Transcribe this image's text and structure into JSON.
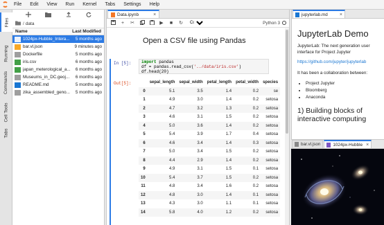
{
  "menubar": {
    "items": [
      "File",
      "Edit",
      "View",
      "Run",
      "Kernel",
      "Tabs",
      "Settings",
      "Help"
    ]
  },
  "sidebar_tabs": [
    "Files",
    "Running",
    "Commands",
    "Cell Tools",
    "Tabs"
  ],
  "filebrowser": {
    "path": "data",
    "col_name": "Name",
    "col_modified": "Last Modified",
    "files": [
      {
        "name": "1024px-Hubble_Intera...",
        "modified": "5 months ago",
        "icon": "image-icon",
        "selected": true
      },
      {
        "name": "bar.vl.json",
        "modified": "9 minutes ago",
        "icon": "json-icon",
        "selected": false
      },
      {
        "name": "Dockerfile",
        "modified": "5 months ago",
        "icon": "file-icon",
        "selected": false
      },
      {
        "name": "iris.csv",
        "modified": "6 months ago",
        "icon": "csv-icon",
        "selected": false
      },
      {
        "name": "japan_meterological_a...",
        "modified": "6 months ago",
        "icon": "csv-icon",
        "selected": false
      },
      {
        "name": "Museums_in_DC.geoj...",
        "modified": "6 months ago",
        "icon": "file-icon",
        "selected": false
      },
      {
        "name": "README.md",
        "modified": "5 months ago",
        "icon": "markdown-icon",
        "selected": false
      },
      {
        "name": "zika_assembled_geno...",
        "modified": "5 months ago",
        "icon": "file-icon",
        "selected": false
      }
    ]
  },
  "notebook": {
    "tab_title": "Data.ipynb",
    "cell_type": "Code",
    "kernel": "Python 3",
    "heading": "Open a CSV file using Pandas",
    "in_prompt": "In [5]:",
    "out_prompt": "Out[5]:",
    "code": {
      "kw_import": "import",
      "mod": " pandas",
      "line2a": "df = pandas.read_csv(",
      "line2s": "'../data/iris.csv'",
      "line2b": ")",
      "line3": "df.head(20)"
    },
    "table": {
      "columns": [
        "",
        "sepal_length",
        "sepal_width",
        "petal_length",
        "petal_width",
        "species"
      ],
      "rows": [
        [
          "0",
          "5.1",
          "3.5",
          "1.4",
          "0.2",
          "se"
        ],
        [
          "1",
          "4.9",
          "3.0",
          "1.4",
          "0.2",
          "setosa"
        ],
        [
          "2",
          "4.7",
          "3.2",
          "1.3",
          "0.2",
          "setosa"
        ],
        [
          "3",
          "4.6",
          "3.1",
          "1.5",
          "0.2",
          "setosa"
        ],
        [
          "4",
          "5.0",
          "3.6",
          "1.4",
          "0.2",
          "setosa"
        ],
        [
          "5",
          "5.4",
          "3.9",
          "1.7",
          "0.4",
          "setosa"
        ],
        [
          "6",
          "4.6",
          "3.4",
          "1.4",
          "0.3",
          "setosa"
        ],
        [
          "7",
          "5.0",
          "3.4",
          "1.5",
          "0.2",
          "setosa"
        ],
        [
          "8",
          "4.4",
          "2.9",
          "1.4",
          "0.2",
          "setosa"
        ],
        [
          "9",
          "4.9",
          "3.1",
          "1.5",
          "0.1",
          "setosa"
        ],
        [
          "10",
          "5.4",
          "3.7",
          "1.5",
          "0.2",
          "setosa"
        ],
        [
          "11",
          "4.8",
          "3.4",
          "1.6",
          "0.2",
          "setosa"
        ],
        [
          "12",
          "4.8",
          "3.0",
          "1.4",
          "0.1",
          "setosa"
        ],
        [
          "13",
          "4.3",
          "3.0",
          "1.1",
          "0.1",
          "setosa"
        ],
        [
          "14",
          "5.8",
          "4.0",
          "1.2",
          "0.2",
          "setosa"
        ]
      ]
    }
  },
  "readme": {
    "tab_title": "jupyterlab.md",
    "h1": "JupyterLab Demo",
    "p1": "JupyterLab: The next generation user interface for Project Jupyter",
    "link": "https://github.com/jupyter/jupyterlab",
    "p2": "It has been a collaboration between:",
    "list": [
      "Project Jupyter",
      "Bloomberg",
      "Anaconda"
    ],
    "h2": "1) Building blocks of interactive computing"
  },
  "image_panel": {
    "tab1": "bar.vl.json",
    "tab2": "1024px-Hubble"
  },
  "colors": {
    "accent": "#2c7be5",
    "logo": "#f37726"
  }
}
